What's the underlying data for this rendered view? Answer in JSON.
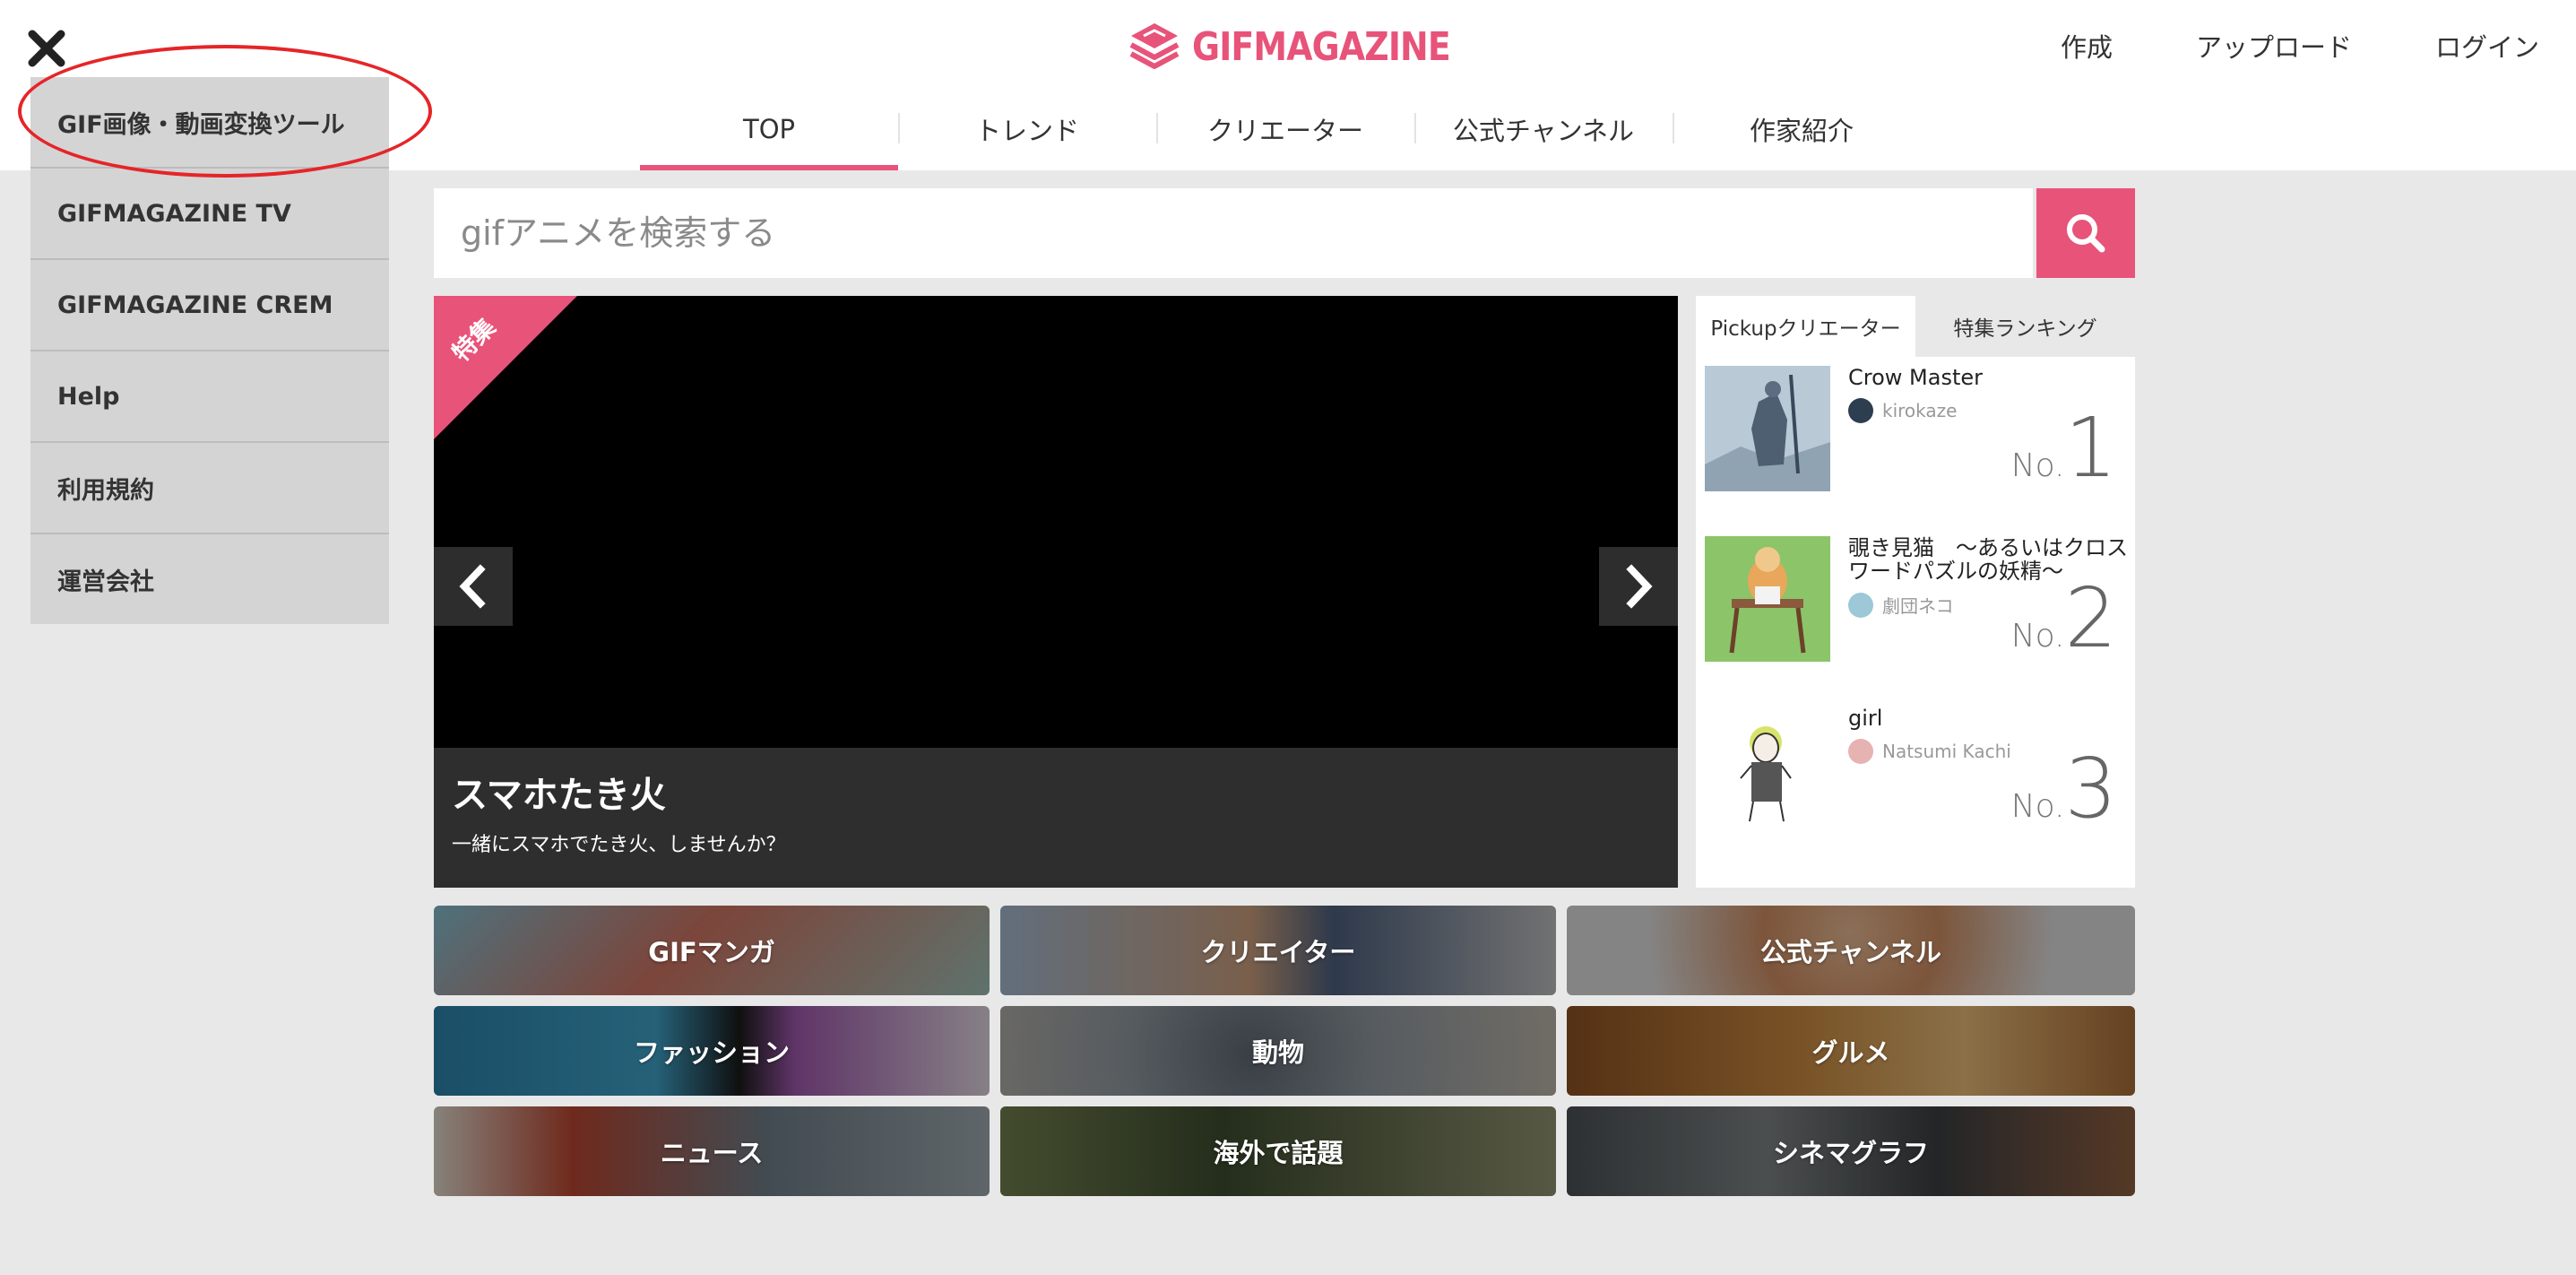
{
  "header": {
    "logo_text": "GIFMAGAZINE",
    "links": [
      "作成",
      "アップロード",
      "ログイン"
    ],
    "nav_tabs": [
      {
        "label": "TOP",
        "active": true
      },
      {
        "label": "トレンド",
        "active": false
      },
      {
        "label": "クリエーター",
        "active": false
      },
      {
        "label": "公式チャンネル",
        "active": false
      },
      {
        "label": "作家紹介",
        "active": false
      }
    ],
    "accent_color": "#e8537a"
  },
  "side_menu": {
    "items": [
      "GIF画像・動画変換ツール",
      "GIFMAGAZINE TV",
      "GIFMAGAZINE CREM",
      "Help",
      "利用規約",
      "運営会社"
    ],
    "highlighted_item": "GIF画像・動画変換ツール",
    "highlight_color": "#e52529"
  },
  "search": {
    "placeholder": "gifアニメを検索する",
    "value": ""
  },
  "slider": {
    "badge": "特集",
    "title": "スマホたき火",
    "subtitle": "一緒にスマホでたき火、しませんか？"
  },
  "ranking": {
    "tabs": [
      {
        "label": "Pickupクリエーター",
        "active": true
      },
      {
        "label": "特集ランキング",
        "active": false
      }
    ],
    "no_label": "No.",
    "items": [
      {
        "rank": "1",
        "title": "Crow Master",
        "author": "kirokaze"
      },
      {
        "rank": "2",
        "title": "覗き見猫　〜あるいはクロスワードパズルの妖精〜",
        "author": "劇団ネコ"
      },
      {
        "rank": "3",
        "title": "girl",
        "author": "Natsumi Kachi"
      }
    ]
  },
  "categories": [
    "GIFマンガ",
    "クリエイター",
    "公式チャンネル",
    "ファッション",
    "動物",
    "グルメ",
    "ニュース",
    "海外で話題",
    "シネマグラフ"
  ],
  "icons": {
    "close": "close-icon",
    "search": "search-icon",
    "prev": "chevron-left-icon",
    "next": "chevron-right-icon",
    "logo": "layers-logo-icon"
  }
}
